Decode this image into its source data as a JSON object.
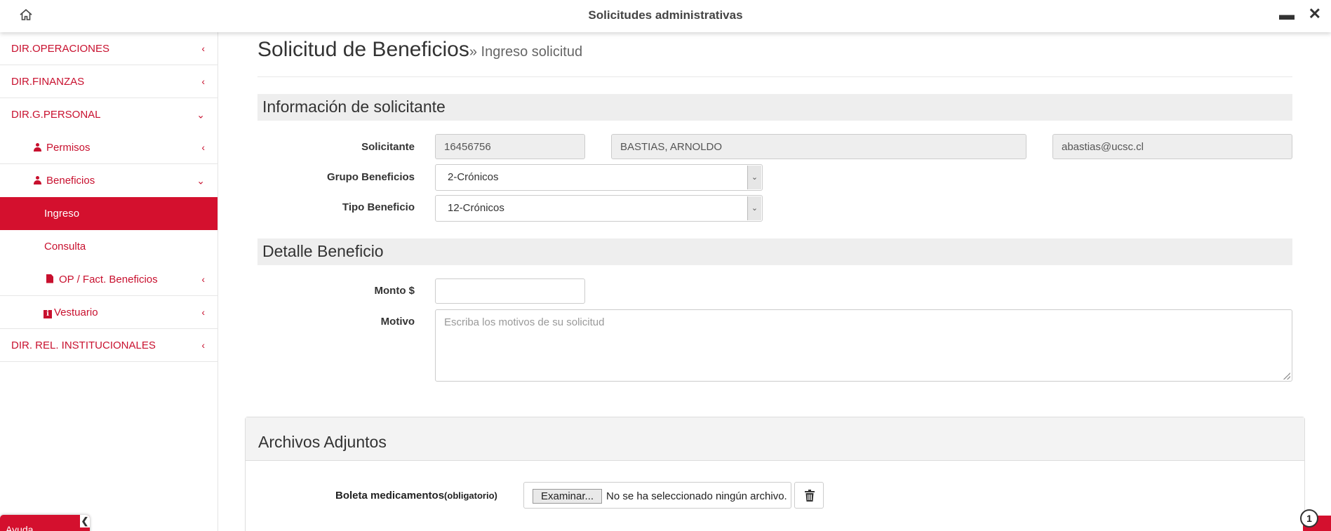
{
  "window": {
    "title": "Solicitudes administrativas",
    "minimize": "▬",
    "close": "✕"
  },
  "sidebar": {
    "items": [
      {
        "label": "DIR.OPERACIONES",
        "chevron": "‹"
      },
      {
        "label": "DIR.FINANZAS",
        "chevron": "‹"
      },
      {
        "label": "DIR.G.PERSONAL",
        "chevron": "⌄"
      },
      {
        "label": "Permisos",
        "chevron": "‹"
      },
      {
        "label": "Beneficios",
        "chevron": "⌄"
      },
      {
        "label": "Ingreso"
      },
      {
        "label": "Consulta"
      },
      {
        "label": "OP / Fact. Beneficios",
        "chevron": "‹"
      },
      {
        "label": "Vestuario",
        "chevron": "‹"
      },
      {
        "label": "DIR. REL. INSTITUCIONALES",
        "chevron": "‹"
      }
    ]
  },
  "badge": {
    "label": "Ayuda",
    "toggle": "❮"
  },
  "page": {
    "title": "Solicitud de Beneficios",
    "subtitle": "» Ingreso solicitud"
  },
  "applicant_section": {
    "heading": "Información de solicitante",
    "solicitante_label": "Solicitante",
    "rut": "16456756",
    "name": "BASTIAS, ARNOLDO",
    "email": "abastias@ucsc.cl",
    "grupo_label": "Grupo Beneficios",
    "grupo_value": "2-Crónicos",
    "tipo_label": "Tipo Beneficio",
    "tipo_value": "12-Crónicos"
  },
  "detail_section": {
    "heading": "Detalle Beneficio",
    "monto_label": "Monto $",
    "monto_value": "",
    "motivo_label": "Motivo",
    "motivo_placeholder": "Escriba los motivos de su solicitud"
  },
  "attachments": {
    "heading": "Archivos Adjuntos",
    "file_label": "Boleta medicamentos",
    "required_note": "(obligatorio)",
    "browse_label": "Examinar...",
    "no_file_text": "No se ha seleccionado ningún archivo."
  },
  "notifications": {
    "count": "1"
  },
  "colors": {
    "accent": "#d4102e",
    "section_bg": "#eeeeee"
  }
}
